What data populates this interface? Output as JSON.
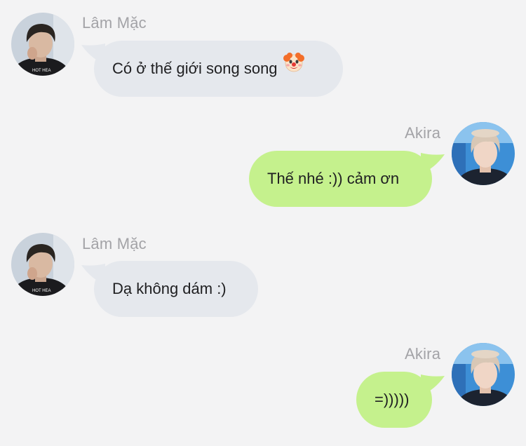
{
  "messages": [
    {
      "sender": "Lâm Mặc",
      "side": "left",
      "text": "Có ở thế giới song song",
      "emoji": "clown-face-emoji"
    },
    {
      "sender": "Akira",
      "side": "right",
      "text": "Thế nhé :)) cảm ơn"
    },
    {
      "sender": "Lâm Mặc",
      "side": "left",
      "text": "Dạ không dám :)"
    },
    {
      "sender": "Akira",
      "side": "right",
      "text": "=)))))"
    }
  ],
  "colors": {
    "background": "#f3f3f4",
    "bubble_left": "#e5e8ed",
    "bubble_right": "#c5f18d",
    "sender_name": "#a3a3a7"
  }
}
